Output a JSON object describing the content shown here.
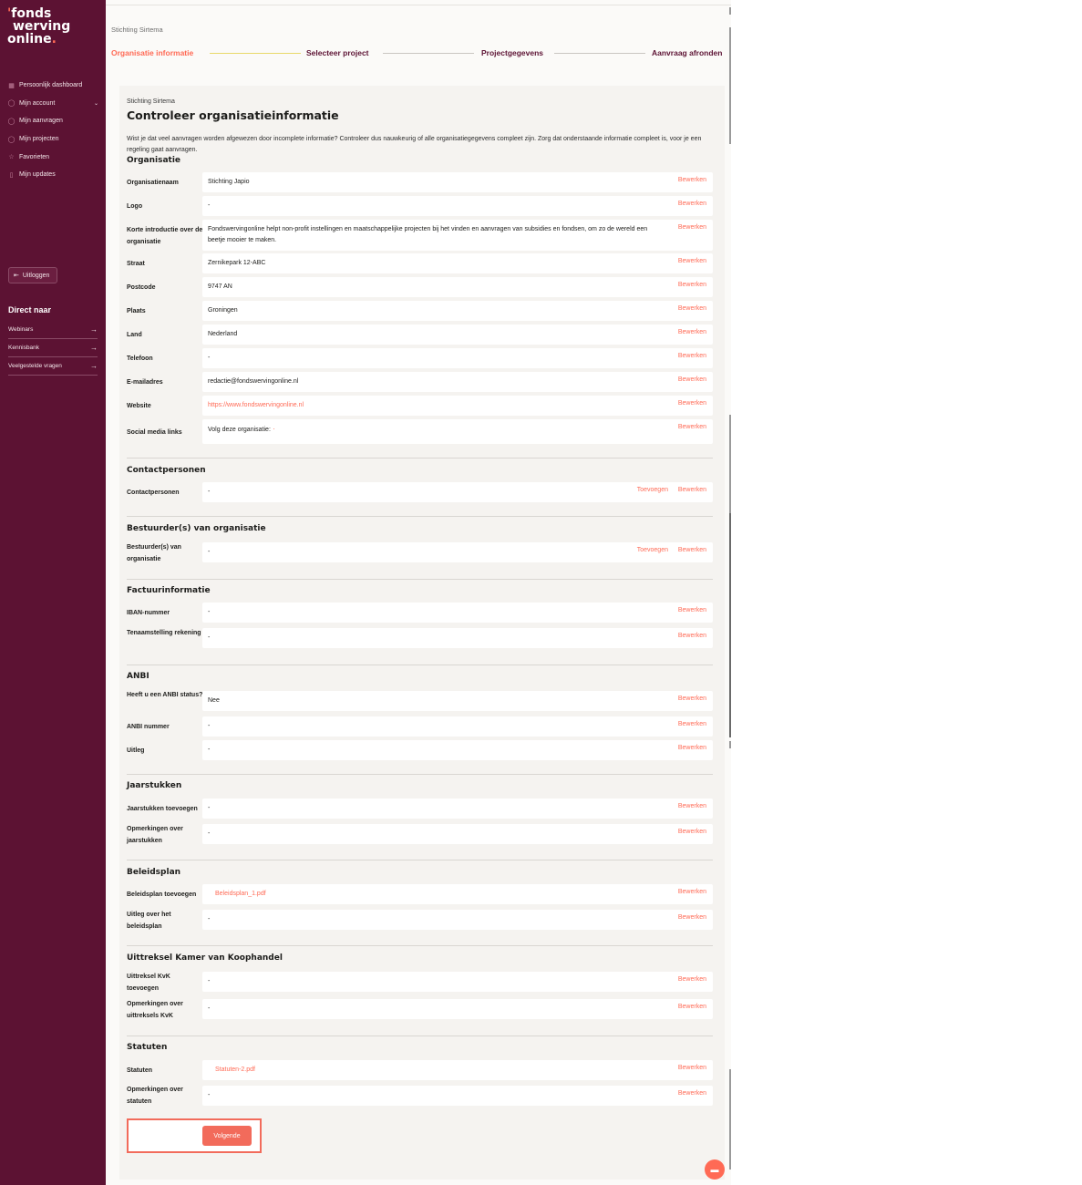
{
  "logo": {
    "line1": "fonds",
    "line2": "werving",
    "line3": "online",
    "tick": "'",
    "dot": "."
  },
  "sidebar": {
    "items": [
      {
        "label": "Persoonlijk dashboard",
        "icon": "grid-icon"
      },
      {
        "label": "Mijn account",
        "icon": "user-icon",
        "chevron": "⌄"
      },
      {
        "label": "Mijn aanvragen",
        "icon": "file-icon"
      },
      {
        "label": "Mijn projecten",
        "icon": "folder-icon"
      },
      {
        "label": "Favorieten",
        "icon": "star-icon"
      },
      {
        "label": "Mijn updates",
        "icon": "bookmark-icon"
      }
    ],
    "logout": "Uitloggen",
    "direct_title": "Direct naar",
    "direct_items": [
      "Webinars",
      "Kennisbank",
      "Veelgestelde vragen"
    ]
  },
  "header": {
    "org": "Stichting Sirtema",
    "steps": [
      "Organisatie informatie",
      "Selecteer project",
      "Projectgegevens",
      "Aanvraag afronden"
    ]
  },
  "card": {
    "sub": "Stichting Sirtema",
    "title": "Controleer organisatieinformatie",
    "intro": "Wist je dat veel aanvragen worden afgewezen door incomplete informatie? Controleer dus nauwkeurig of alle organisatiegegevens compleet zijn. Zorg dat onderstaande informatie compleet is, voor je een regeling gaat aanvragen."
  },
  "labels": {
    "edit": "Bewerken",
    "add": "Toevoegen",
    "next": "Volgende"
  },
  "sections": {
    "organisatie": {
      "title": "Organisatie",
      "rows": [
        {
          "label": "Organisatienaam",
          "value": "Stichting Japio"
        },
        {
          "label": "Logo",
          "value": "-"
        },
        {
          "label": "Korte introductie over de organisatie",
          "value": "Fondswervingonline helpt non-profit instellingen en maatschappelijke projecten bij het vinden en aanvragen van subsidies en fondsen, om zo de wereld een beetje mooier te maken."
        },
        {
          "label": "Straat",
          "value": "Zernikepark 12-ABC"
        },
        {
          "label": "Postcode",
          "value": "9747 AN"
        },
        {
          "label": "Plaats",
          "value": "Groningen"
        },
        {
          "label": "Land",
          "value": "Nederland"
        },
        {
          "label": "Telefoon",
          "value": "-"
        },
        {
          "label": "E-mailadres",
          "value": "redactie@fondswervingonline.nl"
        },
        {
          "label": "Website",
          "value": "https://www.fondswervingonline.nl"
        },
        {
          "label": "Social media links",
          "value": "Volg deze organisatie:"
        }
      ]
    },
    "contact": {
      "title": "Contactpersonen",
      "rows": [
        {
          "label": "Contactpersonen",
          "value": "-"
        }
      ]
    },
    "bestuur": {
      "title": "Bestuurder(s) van organisatie",
      "rows": [
        {
          "label": "Bestuurder(s) van organisatie",
          "value": "-"
        }
      ]
    },
    "factuur": {
      "title": "Factuurinformatie",
      "rows": [
        {
          "label": "IBAN-nummer",
          "value": "-"
        },
        {
          "label": "Tenaamstelling rekening",
          "value": "-"
        }
      ]
    },
    "anbi": {
      "title": "ANBI",
      "rows": [
        {
          "label": "Heeft u een ANBI status?",
          "value": "Nee"
        },
        {
          "label": "ANBI nummer",
          "value": "-"
        },
        {
          "label": "Uitleg",
          "value": "-"
        }
      ]
    },
    "jaarstukken": {
      "title": "Jaarstukken",
      "rows": [
        {
          "label": "Jaarstukken toevoegen",
          "value": "-"
        },
        {
          "label": "Opmerkingen over jaarstukken",
          "value": "-"
        }
      ]
    },
    "beleid": {
      "title": "Beleidsplan",
      "rows": [
        {
          "label": "Beleidsplan toevoegen",
          "value": "Beleidsplan_1.pdf"
        },
        {
          "label": "Uitleg over het beleidsplan",
          "value": "-"
        }
      ]
    },
    "kvk": {
      "title": "Uittreksel Kamer van Koophandel",
      "rows": [
        {
          "label": "Uittreksel KvK toevoegen",
          "value": "-"
        },
        {
          "label": "Opmerkingen over uittreksels KvK",
          "value": "-"
        }
      ]
    },
    "statuten": {
      "title": "Statuten",
      "rows": [
        {
          "label": "Statuten",
          "value": "Statuten-2.pdf"
        },
        {
          "label": "Opmerkingen over statuten",
          "value": "-"
        }
      ]
    }
  },
  "colors": {
    "sidebar": "#5c1233",
    "accent": "#ff6a55",
    "highlight": "#e8d86a"
  }
}
